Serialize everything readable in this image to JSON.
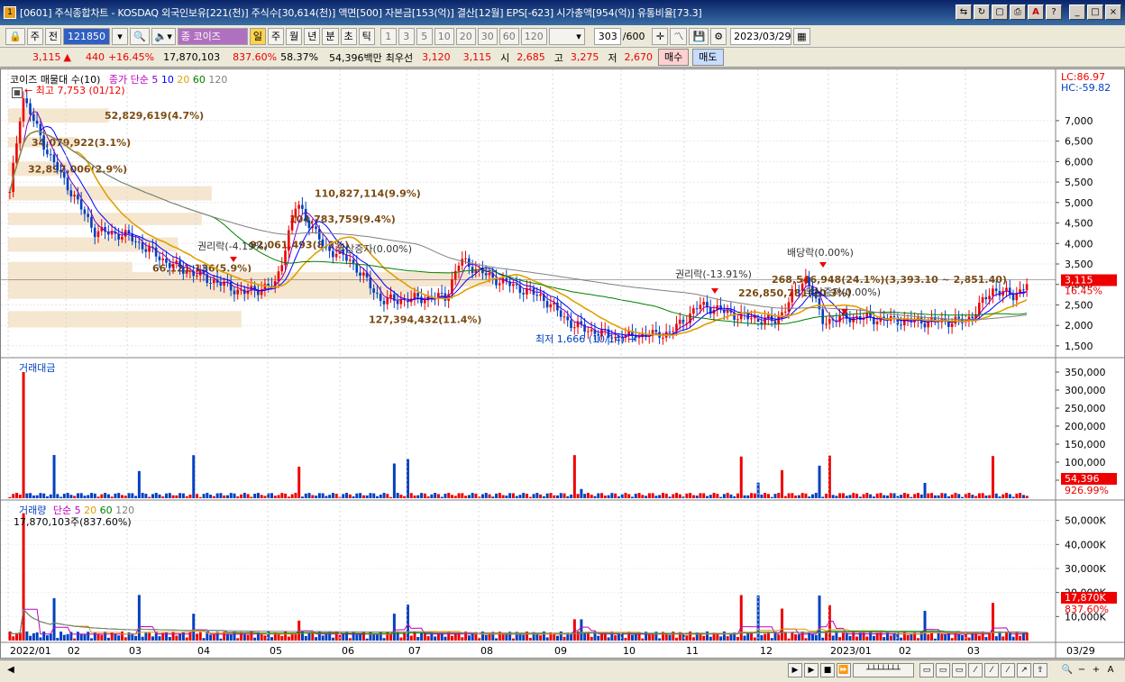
{
  "window": {
    "title": "[0601] 주식종합차트 - KOSDAQ 외국인보유[221(천)] 주식수[30,614(천)] 액면[500] 자본금[153(억)] 결산[12월] EPS[-623] 시가총액[954(억)] 유통비율[73.3]",
    "icon": "chart-app-icon"
  },
  "toolbar1": {
    "type_label": "주",
    "prev_label": "전",
    "code": "121850",
    "name": "코이즈",
    "periods": [
      "일",
      "주",
      "월",
      "년",
      "분",
      "초",
      "틱"
    ],
    "selected_period": "일",
    "intervals": [
      "1",
      "3",
      "5",
      "10",
      "20",
      "30",
      "60",
      "120"
    ],
    "count": "303",
    "count_total": "/600",
    "date": "2023/03/29"
  },
  "quote": {
    "price": "3,115",
    "change": "440",
    "change_pct": "+16.45%",
    "volume": "17,870,103",
    "vol_ratio": "837.60%",
    "turnover": "58.37%",
    "amount": "54,396백만",
    "best_label": "최우선",
    "best_ask": "3,120",
    "best_bid": "3,115",
    "open_label": "시",
    "open": "2,685",
    "high_label": "고",
    "high": "3,275",
    "low_label": "저",
    "low": "2,670",
    "buy_label": "매수",
    "sell_label": "매도"
  },
  "price_panel": {
    "legend_name": "코이즈 매물대 수(10)",
    "legend_ma": "종가 단순",
    "ma_periods": [
      "5",
      "10",
      "20",
      "60",
      "120"
    ],
    "ma_colors": [
      "#8000c0",
      "#0000ff",
      "#e0a000",
      "#008000",
      "#808080"
    ],
    "lc": "LC:86.97",
    "hc": "HC:-59.82",
    "high_marker": "최고 7,753 (01/12)",
    "low_marker": "최저 1,666 (10/14)",
    "current_price_tag": "3,115",
    "current_pct_tag": "16.45%",
    "y_ticks": [
      "7,000",
      "6,500",
      "6,000",
      "5,500",
      "5,000",
      "4,500",
      "4,000",
      "3,500",
      "3,000",
      "2,500",
      "2,000",
      "1,500"
    ],
    "annotations": [
      "권리락(-4.19%)",
      "무상증자(0.00%)",
      "권리락(-13.91%)",
      "배당락(0.00%)",
      "무상증자(0.00%)"
    ],
    "volume_profile": [
      "52,829,619(4.7%)",
      "34,079,922(3.1%)",
      "32,897,006(2.9%)",
      "110,827,114(9.9%)",
      "104,783,759(9.4%)",
      "92,061,493(8.2%)",
      "66,121,136(5.9%)",
      "268,546,948(24.1%)(3,393.10 ~ 2,851.40)",
      "226,850,781(20.3%)",
      "127,394,432(11.4%)"
    ]
  },
  "amount_panel": {
    "title": "거래대금",
    "y_ticks": [
      "350,000",
      "300,000",
      "250,000",
      "200,000",
      "150,000",
      "100,000",
      "50,000"
    ],
    "value_tag": "54,396",
    "pct_tag": "926.99%"
  },
  "volume_panel": {
    "title": "거래량",
    "ma_label": "단순",
    "ma_periods": [
      "5",
      "20",
      "60",
      "120"
    ],
    "current": "17,870,103주(837.60%)",
    "y_ticks": [
      "50,000K",
      "40,000K",
      "30,000K",
      "20,000K",
      "10,000K"
    ],
    "value_tag": "17,870K",
    "pct_tag": "837.60%"
  },
  "x_axis": {
    "labels": [
      "2022/01",
      "02",
      "03",
      "04",
      "05",
      "06",
      "07",
      "08",
      "09",
      "10",
      "11",
      "12",
      "2023/01",
      "02",
      "03"
    ],
    "right_label": "03/29"
  },
  "chart_data": {
    "type": "candlestick",
    "title": "코이즈 매물대 수(10)",
    "price_key_points": [
      {
        "date": "2022/01/12",
        "value": 7753,
        "label": "최고"
      },
      {
        "date": "2022/10/14",
        "value": 1666,
        "label": "최저"
      },
      {
        "date": "2023/03/29",
        "value": 3115,
        "label": "현재가"
      }
    ],
    "volume_profile_pct": [
      4.7,
      3.1,
      2.9,
      9.9,
      9.4,
      8.2,
      5.9,
      24.1,
      20.3,
      11.4
    ],
    "ylim_price": [
      1300,
      7900
    ],
    "ylim_amount": [
      0,
      380000
    ],
    "ylim_volume": [
      0,
      57000
    ]
  }
}
